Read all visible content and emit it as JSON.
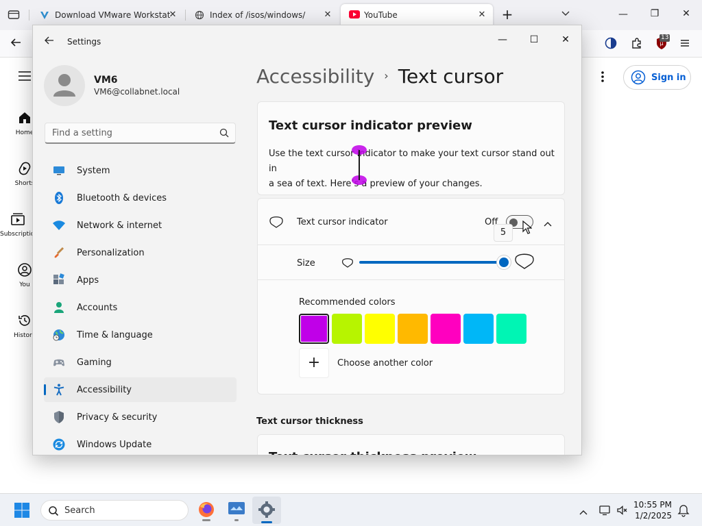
{
  "browser": {
    "tabs": [
      {
        "label": "Download VMware Workstation",
        "active": false
      },
      {
        "label": "Index of /isos/windows/",
        "active": false
      },
      {
        "label": "YouTube",
        "active": true
      }
    ],
    "window_controls": {
      "minimize": "—",
      "restore": "❐",
      "close": "✕"
    },
    "badge_count": "13"
  },
  "youtube": {
    "sign_in": "Sign in",
    "sidebar": [
      "Home",
      "Shorts",
      "Subscriptions",
      "You",
      "History"
    ]
  },
  "settings": {
    "title": "Settings",
    "user": {
      "name": "VM6",
      "email": "VM6@collabnet.local"
    },
    "search_placeholder": "Find a setting",
    "nav": [
      {
        "label": "System",
        "icon": "monitor-icon"
      },
      {
        "label": "Bluetooth & devices",
        "icon": "bluetooth-icon"
      },
      {
        "label": "Network & internet",
        "icon": "wifi-icon"
      },
      {
        "label": "Personalization",
        "icon": "brush-icon"
      },
      {
        "label": "Apps",
        "icon": "apps-icon"
      },
      {
        "label": "Accounts",
        "icon": "person-icon"
      },
      {
        "label": "Time & language",
        "icon": "globe-clock-icon"
      },
      {
        "label": "Gaming",
        "icon": "gamepad-icon"
      },
      {
        "label": "Accessibility",
        "icon": "accessibility-icon",
        "active": true
      },
      {
        "label": "Privacy & security",
        "icon": "shield-icon"
      },
      {
        "label": "Windows Update",
        "icon": "update-icon"
      }
    ],
    "breadcrumb": {
      "parent": "Accessibility",
      "current": "Text cursor"
    },
    "preview": {
      "title": "Text cursor indicator preview",
      "text_line1": "Use the text cursor indicator to make your text cursor stand out in",
      "text_line2": "a sea of text. Here’s a preview of your changes."
    },
    "indicator": {
      "label": "Text cursor indicator",
      "state": "Off",
      "toggle_on": false
    },
    "size": {
      "label": "Size",
      "value": 5,
      "max": 5,
      "tooltip": "5"
    },
    "colors": {
      "heading": "Recommended colors",
      "swatches": [
        "#c000e8",
        "#b7f400",
        "#ffff00",
        "#ffb900",
        "#ff00bf",
        "#00b7f7",
        "#00f5b4"
      ],
      "selected_index": 0,
      "choose_another": "Choose another color"
    },
    "thickness": {
      "heading": "Text cursor thickness",
      "preview_title": "Text cursor thickness preview"
    },
    "accent": "#0067c0"
  },
  "taskbar": {
    "search_placeholder": "Search",
    "time": "10:55 PM",
    "date": "1/2/2025"
  }
}
